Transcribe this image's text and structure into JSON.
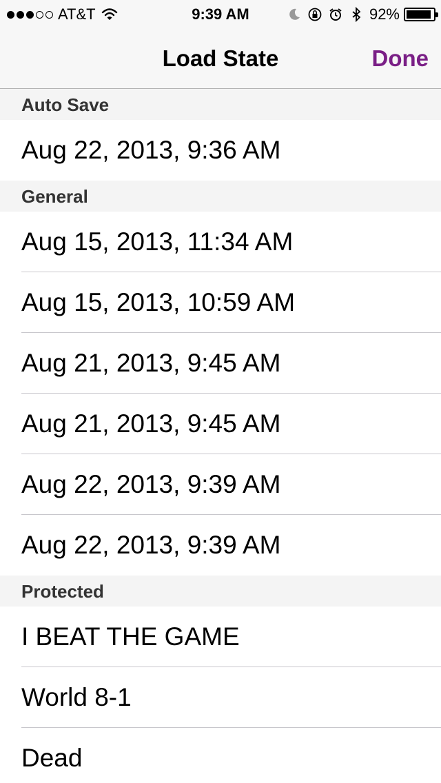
{
  "status_bar": {
    "signal_filled": 3,
    "signal_total": 5,
    "carrier": "AT&T",
    "wifi_icon": "wifi-icon",
    "time": "9:39 AM",
    "moon_icon": "moon-icon",
    "lock_icon": "rotation-lock-icon",
    "alarm_icon": "alarm-icon",
    "bluetooth_icon": "bluetooth-icon",
    "battery_percent": "92%",
    "battery_level": 0.92
  },
  "nav": {
    "title": "Load State",
    "done_label": "Done",
    "accent_color": "#7a1f86"
  },
  "sections": [
    {
      "header": "Auto Save",
      "items": [
        "Aug 22, 2013, 9:36 AM"
      ]
    },
    {
      "header": "General",
      "items": [
        "Aug 15, 2013, 11:34 AM",
        "Aug 15, 2013, 10:59 AM",
        "Aug 21, 2013, 9:45 AM",
        "Aug 21, 2013, 9:45 AM",
        "Aug 22, 2013, 9:39 AM",
        "Aug 22, 2013, 9:39 AM"
      ]
    },
    {
      "header": "Protected",
      "items": [
        "I BEAT THE GAME",
        "World 8-1",
        "Dead"
      ]
    }
  ]
}
